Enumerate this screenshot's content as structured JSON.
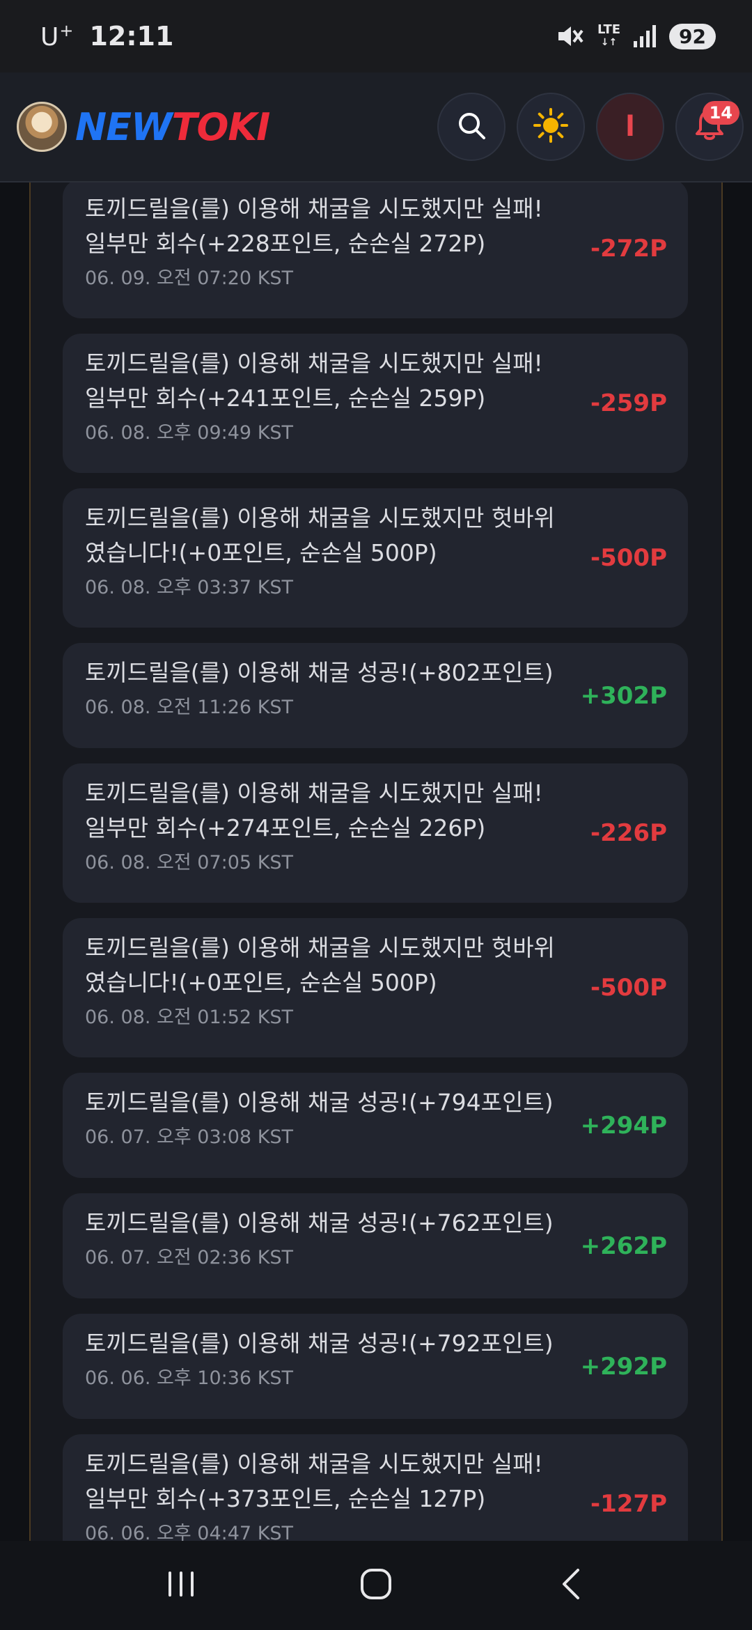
{
  "status_bar": {
    "carrier": "U",
    "carrier_sup": "+",
    "time": "12:11",
    "network": "LTE",
    "battery": "92"
  },
  "header": {
    "brand_part1": "NEW",
    "brand_part2": "TOKI",
    "user_initial": "l",
    "notification_count": "14"
  },
  "colors": {
    "positive": "#2fb25a",
    "negative": "#e23b3f",
    "brand_blue": "#1f74f4",
    "brand_red": "#ee2b3a"
  },
  "transactions": [
    {
      "line1": "토끼드릴을(를) 이용해 채굴을 시도했지만 실패!",
      "line2": "일부만 회수(+228포인트, 순손실 272P)",
      "time": "06. 09. 오전 07:20 KST",
      "amount": "-272P",
      "type": "neg"
    },
    {
      "line1": "토끼드릴을(를) 이용해 채굴을 시도했지만 실패!",
      "line2": "일부만 회수(+241포인트, 순손실 259P)",
      "time": "06. 08. 오후 09:49 KST",
      "amount": "-259P",
      "type": "neg"
    },
    {
      "line1": "토끼드릴을(를) 이용해 채굴을 시도했지만 헛바위",
      "line2": "였습니다!(+0포인트, 순손실 500P)",
      "time": "06. 08. 오후 03:37 KST",
      "amount": "-500P",
      "type": "neg"
    },
    {
      "line1": "토끼드릴을(를) 이용해 채굴 성공!(+802포인트)",
      "line2": "",
      "time": "06. 08. 오전 11:26 KST",
      "amount": "+302P",
      "type": "pos"
    },
    {
      "line1": "토끼드릴을(를) 이용해 채굴을 시도했지만 실패!",
      "line2": "일부만 회수(+274포인트, 순손실 226P)",
      "time": "06. 08. 오전 07:05 KST",
      "amount": "-226P",
      "type": "neg"
    },
    {
      "line1": "토끼드릴을(를) 이용해 채굴을 시도했지만 헛바위",
      "line2": "였습니다!(+0포인트, 순손실 500P)",
      "time": "06. 08. 오전 01:52 KST",
      "amount": "-500P",
      "type": "neg"
    },
    {
      "line1": "토끼드릴을(를) 이용해 채굴 성공!(+794포인트)",
      "line2": "",
      "time": "06. 07. 오후 03:08 KST",
      "amount": "+294P",
      "type": "pos"
    },
    {
      "line1": "토끼드릴을(를) 이용해 채굴 성공!(+762포인트)",
      "line2": "",
      "time": "06. 07. 오전 02:36 KST",
      "amount": "+262P",
      "type": "pos"
    },
    {
      "line1": "토끼드릴을(를) 이용해 채굴 성공!(+792포인트)",
      "line2": "",
      "time": "06. 06. 오후 10:36 KST",
      "amount": "+292P",
      "type": "pos"
    },
    {
      "line1": "토끼드릴을(를) 이용해 채굴을 시도했지만 실패!",
      "line2": "일부만 회수(+373포인트, 순손실 127P)",
      "time": "06. 06. 오후 04:47 KST",
      "amount": "-127P",
      "type": "neg"
    }
  ]
}
